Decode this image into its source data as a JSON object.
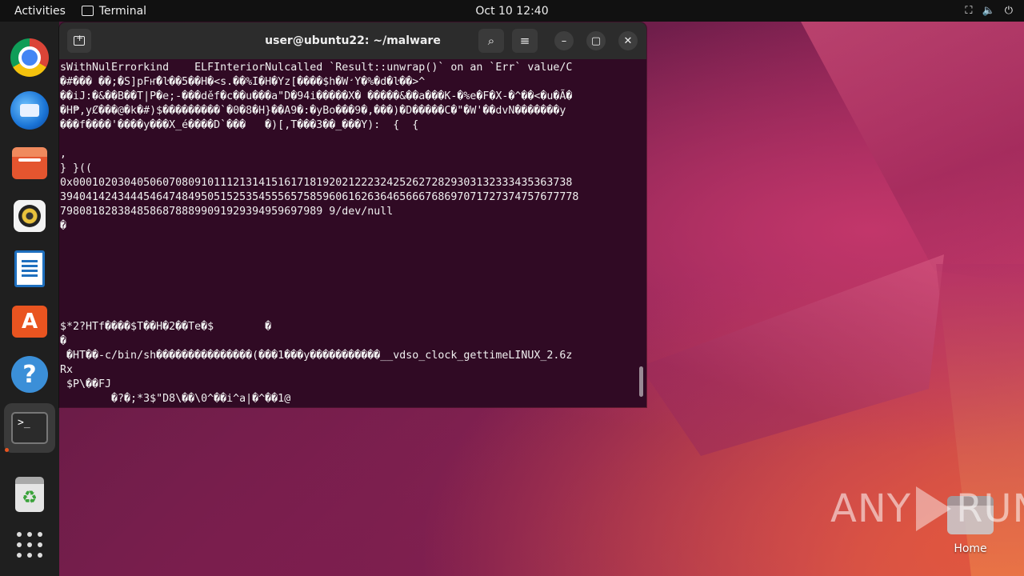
{
  "topbar": {
    "activities": "Activities",
    "app_name": "Terminal",
    "clock": "Oct 10  12:40"
  },
  "dock": {
    "items": [
      "chrome",
      "thunderbird",
      "files",
      "rhythmbox",
      "libreoffice-writer",
      "app-center",
      "help",
      "terminal",
      "trash",
      "show-applications"
    ]
  },
  "window": {
    "title": "user@ubuntu22: ~/malware"
  },
  "terminal": {
    "lines": [
      "sWithNulErrorkind    ELFInteriorNulcalled `Result::unwrap()` on an `Err` value/C",
      "�#��� ��;�S]pFҥ̂�ŀ��5��H�<s.��%I�H�Yz[����$h�W̛Y�%�d�ŀ��>^",
      "��iJ:�&��B��T|P�e;-���děf�c��u���a\"D�94i�����X� �����&��a���K-�%e�F�X-�^��<�u�Ã�",
      "�H₱,yȻ���@�k�#)$���������`�0�8�H}��A9�:�yBo���9�,���)�D�����C�\"�W'��dvN�������y",
      "���f����'����y���X_é����D`���   �)[,T���3��_���Y):  {  {",
      "",
      ",",
      "} }((",
      "0x000102030405060708091011121314151617181920212223242526272829303132333435363738",
      "394041424344454647484950515253545556575859606162636465666768697071727374757677778",
      "79808182838485868788899091929394959697989 9/dev/null",
      "�",
      "",
      "",
      "",
      "",
      "",
      "",
      "$*2?HTf����$T��H�2��Te�$        �",
      "�",
      " �HT��-c/bin/sh���������������(���1���y�����������__vdso_clock_gettimeLINUX_2.6z",
      "Rx",
      " $P\\��FJ",
      "        �?�;*3$\"D8\\��\\0^��i^a|�^��1@"
    ]
  },
  "desktop": {
    "home_label": "Home",
    "watermark_left": "ANY",
    "watermark_right": "RUN"
  }
}
